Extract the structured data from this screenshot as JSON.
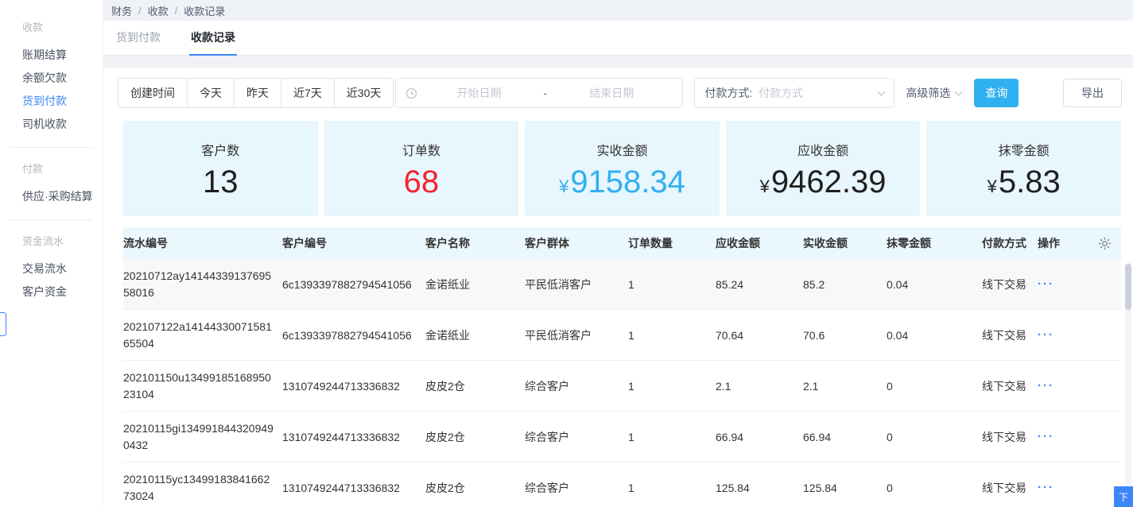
{
  "colors": {
    "accent_blue": "#3d86f5",
    "cyan": "#2fb0f0",
    "red": "#f5222d",
    "dark": "#1f1f1f"
  },
  "breadcrumb": {
    "separator": "/",
    "items": [
      "财务",
      "收款",
      "收款记录"
    ]
  },
  "sidebar": {
    "sections": [
      {
        "title": "收款",
        "items": [
          {
            "label": "账期结算",
            "active": false
          },
          {
            "label": "余额欠款",
            "active": false
          },
          {
            "label": "货到付款",
            "active": true
          },
          {
            "label": "司机收款",
            "active": false
          }
        ]
      },
      {
        "title": "付款",
        "items": [
          {
            "label": "供应·采购结算",
            "active": false
          }
        ]
      },
      {
        "title": "资金流水",
        "items": [
          {
            "label": "交易流水",
            "active": false
          },
          {
            "label": "客户资金",
            "active": false
          }
        ]
      }
    ]
  },
  "tabs": [
    {
      "label": "货到付款",
      "active": false
    },
    {
      "label": "收款记录",
      "active": true
    }
  ],
  "filters": {
    "date_label": "创建时间",
    "quick_buttons": [
      "今天",
      "昨天",
      "近7天",
      "近30天"
    ],
    "start_placeholder": "开始日期",
    "range_separator": "-",
    "end_placeholder": "结束日期",
    "payment_label": "付款方式:",
    "payment_placeholder": "付款方式",
    "advanced_label": "高级筛选",
    "search_button": "查询",
    "export_button": "导出"
  },
  "stats": [
    {
      "label": "客户数",
      "prefix": "",
      "value": "13",
      "color": "#1f1f1f"
    },
    {
      "label": "订单数",
      "prefix": "",
      "value": "68",
      "color": "#f5222d"
    },
    {
      "label": "实收金额",
      "prefix": "¥",
      "value": "9158.34",
      "color": "#2fb0f0"
    },
    {
      "label": "应收金额",
      "prefix": "¥",
      "value": "9462.39",
      "color": "#1f1f1f"
    },
    {
      "label": "抹零金额",
      "prefix": "¥",
      "value": "5.83",
      "color": "#1f1f1f"
    }
  ],
  "table": {
    "headers": [
      "流水编号",
      "客户编号",
      "客户名称",
      "客户群体",
      "订单数量",
      "应收金额",
      "实收金额",
      "抹零金额",
      "付款方式",
      "操作"
    ],
    "column_keys": [
      "serial",
      "customer_no",
      "customer_name",
      "customer_group",
      "order_count",
      "receivable",
      "received",
      "rounding",
      "payment_method"
    ],
    "action_ellipsis": "···",
    "rows": [
      {
        "serial": "20210712ay1414433913769558016",
        "customer_no": "6c1393397882794541056",
        "customer_name": "金诺纸业",
        "customer_group": "平民低消客户",
        "order_count": "1",
        "receivable": "85.24",
        "received": "85.2",
        "rounding": "0.04",
        "payment_method": "线下交易",
        "shaded": true
      },
      {
        "serial": "202107122a1414433007158165504",
        "customer_no": "6c1393397882794541056",
        "customer_name": "金诺纸业",
        "customer_group": "平民低消客户",
        "order_count": "1",
        "receivable": "70.64",
        "received": "70.6",
        "rounding": "0.04",
        "payment_method": "线下交易",
        "shaded": false
      },
      {
        "serial": "202101150u1349918516895023104",
        "customer_no": "1310749244713336832",
        "customer_name": "皮皮2仓",
        "customer_group": "综合客户",
        "order_count": "1",
        "receivable": "2.1",
        "received": "2.1",
        "rounding": "0",
        "payment_method": "线下交易",
        "shaded": false
      },
      {
        "serial": "20210115gi1349918443209490432",
        "customer_no": "1310749244713336832",
        "customer_name": "皮皮2仓",
        "customer_group": "综合客户",
        "order_count": "1",
        "receivable": "66.94",
        "received": "66.94",
        "rounding": "0",
        "payment_method": "线下交易",
        "shaded": false
      },
      {
        "serial": "20210115yc1349918384166273024",
        "customer_no": "1310749244713336832",
        "customer_name": "皮皮2仓",
        "customer_group": "综合客户",
        "order_count": "1",
        "receivable": "125.84",
        "received": "125.84",
        "rounding": "0",
        "payment_method": "线下交易",
        "shaded": false
      }
    ]
  },
  "floating": {
    "bottom_button_label": "下"
  }
}
